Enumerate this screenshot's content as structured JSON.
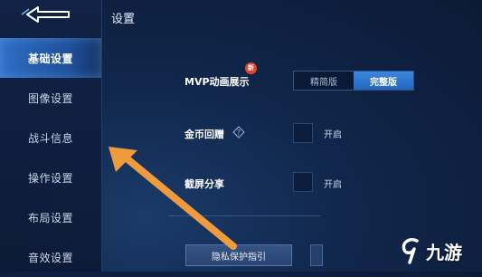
{
  "page": {
    "title": "设置"
  },
  "sidebar": {
    "items": [
      {
        "label": "基础设置",
        "active": true
      },
      {
        "label": "图像设置",
        "active": false
      },
      {
        "label": "战斗信息",
        "active": false
      },
      {
        "label": "操作设置",
        "active": false
      },
      {
        "label": "布局设置",
        "active": false
      },
      {
        "label": "音效设置",
        "active": false
      }
    ]
  },
  "settings": {
    "mvp": {
      "label": "MVP动画展示",
      "badge": "新",
      "options": [
        "精简版",
        "完整版"
      ],
      "selected": "完整版"
    },
    "coin_reward": {
      "label": "金币回赠",
      "toggle_label": "开启",
      "checked": false
    },
    "screenshot_share": {
      "label": "截屏分享",
      "toggle_label": "开启",
      "checked": false
    }
  },
  "privacy_button": {
    "label": "隐私保护指引"
  },
  "watermark": {
    "text": "九游"
  },
  "colors": {
    "accent": "#2f6fc4",
    "arrow": "#f09a3e",
    "badge": "#e2452f"
  }
}
